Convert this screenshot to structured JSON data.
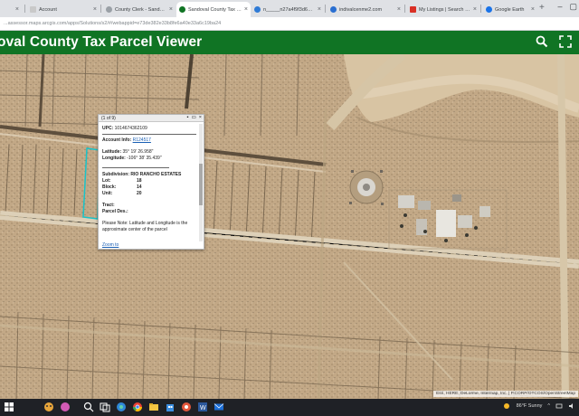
{
  "browser": {
    "tabs": [
      {
        "title": "Account",
        "favicon_color": "#c9c9c9"
      },
      {
        "title": "County Clerk - Sandoval",
        "favicon_color": "#9aa0a6"
      },
      {
        "title": "Sandoval County Tax Par",
        "favicon_color": "#107424"
      },
      {
        "title": "n_____n27a4f9f3d6db5",
        "favicon_color": "#2f7bd6"
      },
      {
        "title": "indivalcenme2.com",
        "favicon_color": "#2a6fd1"
      },
      {
        "title": "My Listings | Search Re",
        "favicon_color": "#d93025"
      },
      {
        "title": "Google Earth",
        "favicon_color": "#1a73e8"
      }
    ],
    "address": "...assessor.maps.arcgis.com/apps/Solutions/s2/#/webappid=e73de382e33b8fe6a40e33a6c19ba24"
  },
  "app": {
    "title": "oval County Tax Parcel Viewer",
    "header_icons": [
      "search-icon",
      "zoom-extent-icon"
    ]
  },
  "map": {
    "road_labels": [
      "",
      ""
    ],
    "attribution": "Esri, HERE, DeLorme, Intermap, Inc. | P.CORP/OTCOS/OpenStreetMap",
    "overlay_color": "#19c3c9"
  },
  "popup": {
    "count": "(1 of 9)",
    "controls": [
      "maximize-icon",
      "dock-icon",
      "close-icon"
    ],
    "upc_label": "UPC:",
    "upc_value": "1014674362109",
    "account_label": "Account Info:",
    "account_value": "R124517",
    "latitude_label": "Latitude:",
    "latitude_value": "35° 19' 26.958\"",
    "longitude_label": "Longitude:",
    "longitude_value": "-106° 38' 35.439\"",
    "subdivision_label": "Subdivision:",
    "subdivision_value": "RIO RANCHO ESTATES",
    "lot_label": "Lot:",
    "lot_value": "18",
    "block_label": "Block:",
    "block_value": "14",
    "unit_label": "Unit:",
    "unit_value": "20",
    "tract_label": "Tract:",
    "parcel_desc_label": "Parcel Des.:",
    "note": "Please Note: Latitude and Longitude is the approximate center of the parcel",
    "zoom_link": "Zoom to"
  },
  "taskbar": {
    "weather": "86°F  Sunny",
    "items": [
      "start-icon",
      "search-icon",
      "task-view-icon",
      "edge-icon",
      "file-explorer-icon",
      "chrome-icon",
      "store-icon",
      "mail-icon",
      "word-icon",
      "photos-icon",
      "app-icon"
    ]
  }
}
